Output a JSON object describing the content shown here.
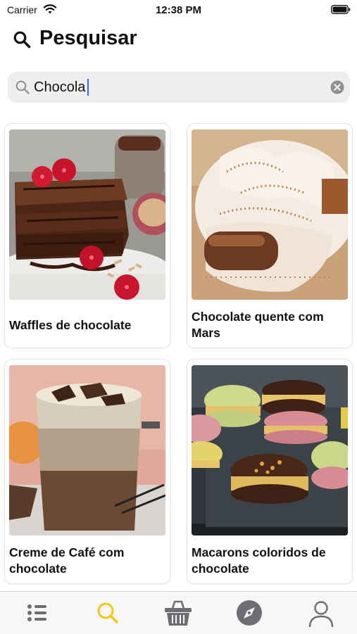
{
  "status_bar": {
    "carrier": "Carrier",
    "time": "12:38 PM"
  },
  "header": {
    "title": "Pesquisar",
    "icon": "search-icon"
  },
  "search": {
    "value": "Chocola",
    "clear_icon": "clear-icon"
  },
  "results": [
    {
      "title": "Waffles de chocolate"
    },
    {
      "title": "Chocolate quente com Mars"
    },
    {
      "title": "Creme de Café com chocolate"
    },
    {
      "title": "Macarons coloridos de chocolate"
    }
  ],
  "tab_bar": {
    "active_index": 1,
    "tabs": [
      {
        "icon": "list-icon"
      },
      {
        "icon": "search-icon"
      },
      {
        "icon": "basket-icon"
      },
      {
        "icon": "compass-icon"
      },
      {
        "icon": "profile-icon"
      }
    ]
  },
  "colors": {
    "accent": "#f5c518",
    "inactive": "#6d6d72",
    "caret": "#2f6df6"
  }
}
